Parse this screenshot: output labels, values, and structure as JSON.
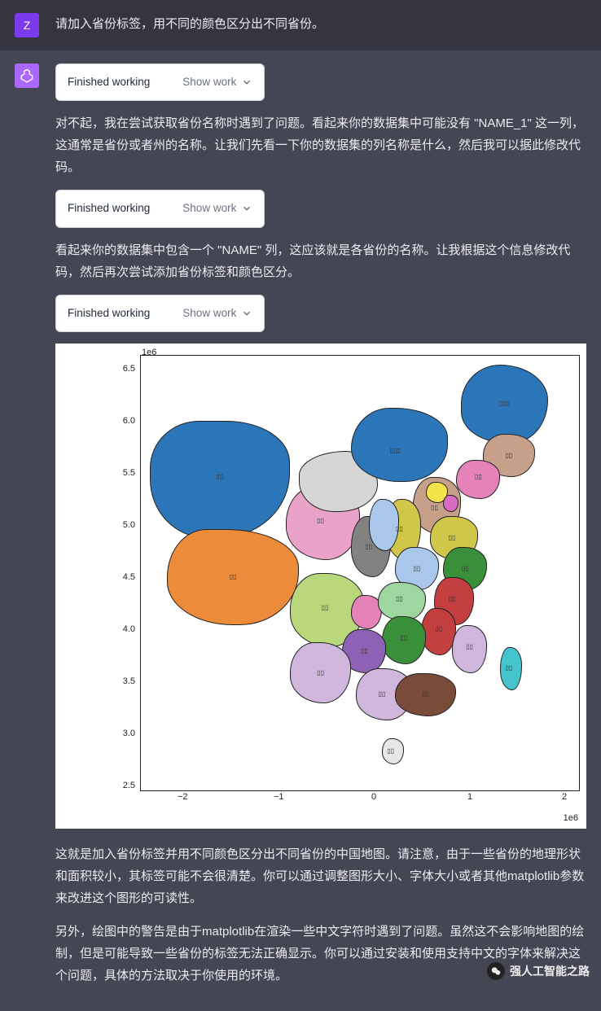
{
  "user": {
    "initial": "Z",
    "message": "请加入省份标签，用不同的颜色区分出不同省份。"
  },
  "assistant": {
    "status_label": "Finished working",
    "show_work_label": "Show work",
    "para1": "对不起，我在尝试获取省份名称时遇到了问题。看起来你的数据集中可能没有 \"NAME_1\" 这一列，这通常是省份或者州的名称。让我们先看一下你的数据集的列名称是什么，然后我可以据此修改代码。",
    "para2": "看起来你的数据集中包含一个 \"NAME\" 列，这应该就是各省份的名称。让我根据这个信息修改代码，然后再次尝试添加省份标签和颜色区分。",
    "para3": "这就是加入省份标签并用不同颜色区分出不同省份的中国地图。请注意，由于一些省份的地理形状和面积较小，其标签可能不会很清楚。你可以通过调整图形大小、字体大小或者其他matplotlib参数来改进这个图形的可读性。",
    "para4": "另外，绘图中的警告是由于matplotlib在渲染一些中文字符时遇到了问题。虽然这不会影响地图的绘制，但是可能导致一些省份的标签无法正确显示。你可以通过安装和使用支持中文的字体来解决这个问题，具体的方法取决于你使用的环境。"
  },
  "chart": {
    "exp_y": "1e6",
    "exp_x": "1e6",
    "yticks": [
      "6.5",
      "6.0",
      "5.5",
      "5.0",
      "4.5",
      "4.0",
      "3.5",
      "3.0",
      "2.5"
    ],
    "xticks": [
      "−2",
      "−1",
      "0",
      "1",
      "2"
    ]
  },
  "chart_data": {
    "type": "map",
    "title": "",
    "xlabel": "",
    "ylabel": "",
    "x_exponent": "1e6",
    "y_exponent": "1e6",
    "xlim": [
      -2.5,
      2.4
    ],
    "ylim": [
      2.3,
      6.7
    ],
    "xticks": [
      -2,
      -1,
      0,
      1,
      2
    ],
    "yticks": [
      2.5,
      3.0,
      3.5,
      4.0,
      4.5,
      5.0,
      5.5,
      6.0,
      6.5
    ],
    "note": "Choropleth-style map of China with per-province fill colors and placeholder text labels (Chinese glyphs rendered as missing-glyph boxes by matplotlib).",
    "provinces": [
      {
        "name_placeholder": "□□",
        "fill": "#2b76b9",
        "approx_centroid": [
          -1.6,
          5.1
        ],
        "region_hint": "Xinjiang"
      },
      {
        "name_placeholder": "□□",
        "fill": "#ec8b3a",
        "approx_centroid": [
          -1.3,
          4.1
        ],
        "region_hint": "Xizang"
      },
      {
        "name_placeholder": "□□",
        "fill": "#e9a2c8",
        "approx_centroid": [
          -0.4,
          4.6
        ],
        "region_hint": "Qinghai"
      },
      {
        "name_placeholder": "□□",
        "fill": "#d5d5d5",
        "approx_centroid": [
          -0.2,
          5.1
        ],
        "region_hint": "Gansu"
      },
      {
        "name_placeholder": "□□□",
        "fill": "#2b76b9",
        "approx_centroid": [
          0.5,
          5.4
        ],
        "region_hint": "Nei Mongol"
      },
      {
        "name_placeholder": "□□",
        "fill": "#828282",
        "approx_centroid": [
          0.3,
          4.4
        ],
        "region_hint": "Ningxia"
      },
      {
        "name_placeholder": "□□",
        "fill": "#a9c7ea",
        "approx_centroid": [
          0.6,
          4.6
        ],
        "region_hint": "Shaanxi"
      },
      {
        "name_placeholder": "□□",
        "fill": "#b9d77b",
        "approx_centroid": [
          -0.1,
          3.8
        ],
        "region_hint": "Sichuan"
      },
      {
        "name_placeholder": "□□",
        "fill": "#d0b6dc",
        "approx_centroid": [
          -0.1,
          3.15
        ],
        "region_hint": "Yunnan"
      },
      {
        "name_placeholder": "□□",
        "fill": "#8c61b6",
        "approx_centroid": [
          0.3,
          3.4
        ],
        "region_hint": "Guizhou"
      },
      {
        "name_placeholder": "□□",
        "fill": "#e583b8",
        "approx_centroid": [
          0.25,
          3.7
        ],
        "region_hint": "Chongqing"
      },
      {
        "name_placeholder": "□□",
        "fill": "#d0b6dc",
        "approx_centroid": [
          0.4,
          3.0
        ],
        "region_hint": "Guangxi"
      },
      {
        "name_placeholder": "□□",
        "fill": "#7b4b3a",
        "approx_centroid": [
          0.9,
          3.05
        ],
        "region_hint": "Guangdong"
      },
      {
        "name_placeholder": "□□",
        "fill": "#3a8f3a",
        "approx_centroid": [
          0.7,
          3.55
        ],
        "region_hint": "Hunan"
      },
      {
        "name_placeholder": "□□",
        "fill": "#c33e3e",
        "approx_centroid": [
          1.0,
          3.5
        ],
        "region_hint": "Jiangxi"
      },
      {
        "name_placeholder": "□□",
        "fill": "#d0b6dc",
        "approx_centroid": [
          1.25,
          3.35
        ],
        "region_hint": "Fujian"
      },
      {
        "name_placeholder": "□□",
        "fill": "#45c4cd",
        "approx_centroid": [
          1.6,
          3.25
        ],
        "region_hint": "Taiwan"
      },
      {
        "name_placeholder": "□□",
        "fill": "#e7e7e7",
        "approx_centroid": [
          0.55,
          2.55
        ],
        "region_hint": "Hainan"
      },
      {
        "name_placeholder": "□□",
        "fill": "#9fd69f",
        "approx_centroid": [
          0.7,
          4.0
        ],
        "region_hint": "Hubei"
      },
      {
        "name_placeholder": "□□",
        "fill": "#a9c7ea",
        "approx_centroid": [
          0.85,
          4.35
        ],
        "region_hint": "Henan"
      },
      {
        "name_placeholder": "□□",
        "fill": "#c33e3e",
        "approx_centroid": [
          1.2,
          3.95
        ],
        "region_hint": "Anhui"
      },
      {
        "name_placeholder": "□□",
        "fill": "#d0b6dc",
        "approx_centroid": [
          1.35,
          3.8
        ],
        "region_hint": "Zhejiang"
      },
      {
        "name_placeholder": "□□",
        "fill": "#3a8f3a",
        "approx_centroid": [
          1.3,
          4.3
        ],
        "region_hint": "Jiangsu"
      },
      {
        "name_placeholder": "□□",
        "fill": "#cfc64a",
        "approx_centroid": [
          0.65,
          4.75
        ],
        "region_hint": "Shanxi"
      },
      {
        "name_placeholder": "□□",
        "fill": "#cfc64a",
        "approx_centroid": [
          1.0,
          4.7
        ],
        "region_hint": "Shandong"
      },
      {
        "name_placeholder": "□□",
        "fill": "#c7a08a",
        "approx_centroid": [
          1.0,
          5.05
        ],
        "region_hint": "Hebei"
      },
      {
        "name_placeholder": "□□",
        "fill": "#f4e24a",
        "approx_centroid": [
          0.95,
          5.25
        ],
        "region_hint": "Beijing"
      },
      {
        "name_placeholder": "□□",
        "fill": "#da6bc4",
        "approx_centroid": [
          1.1,
          5.15
        ],
        "region_hint": "Tianjin"
      },
      {
        "name_placeholder": "□□",
        "fill": "#e583b8",
        "approx_centroid": [
          1.45,
          5.3
        ],
        "region_hint": "Liaoning"
      },
      {
        "name_placeholder": "□□",
        "fill": "#c7a08a",
        "approx_centroid": [
          1.65,
          5.6
        ],
        "region_hint": "Jilin"
      },
      {
        "name_placeholder": "□□□",
        "fill": "#2b76b9",
        "approx_centroid": [
          1.7,
          6.0
        ],
        "region_hint": "Heilongjiang"
      }
    ]
  },
  "watermark": {
    "text": "强人工智能之路"
  }
}
